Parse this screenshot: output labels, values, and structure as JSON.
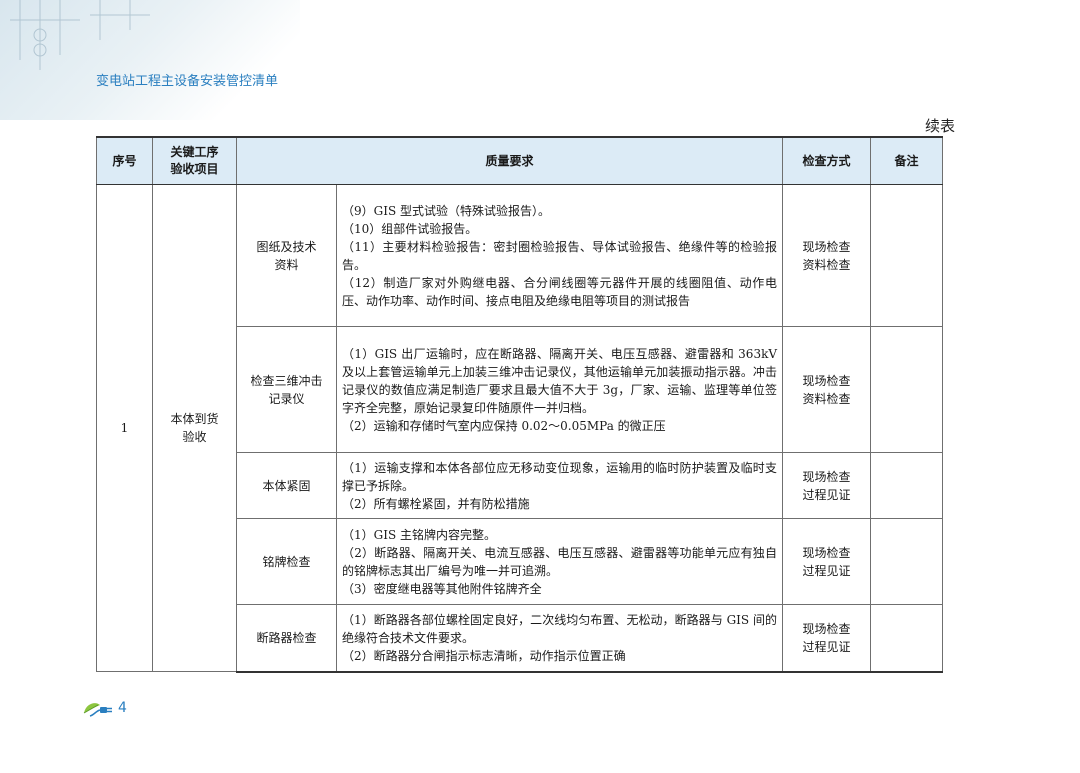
{
  "header": {
    "title": "变电站工程主设备安装管控清单"
  },
  "continued_label": "续表",
  "table": {
    "headers": {
      "no": "序号",
      "item": "关键工序\n验收项目",
      "req": "质量要求",
      "method": "检查方式",
      "note": "备注"
    },
    "group": {
      "no": "1",
      "name": "本体到货\n验收"
    },
    "rows": [
      {
        "sub": "图纸及技术\n资料",
        "req": [
          "（9）GIS 型式试验（特殊试验报告）。",
          "（10）组部件试验报告。",
          "（11）主要材料检验报告：密封圈检验报告、导体试验报告、绝缘件等的检验报告。",
          "（12）制造厂家对外购继电器、合分闸线圈等元器件开展的线圈阻值、动作电压、动作功率、动作时间、接点电阻及绝缘电阻等项目的测试报告"
        ],
        "method": "现场检查\n资料检查",
        "note": ""
      },
      {
        "sub": "检查三维冲击\n记录仪",
        "req": [
          "（1）GIS 出厂运输时，应在断路器、隔离开关、电压互感器、避雷器和 363kV 及以上套管运输单元上加装三维冲击记录仪，其他运输单元加装振动指示器。冲击记录仪的数值应满足制造厂要求且最大值不大于 3g，厂家、运输、监理等单位签字齐全完整，原始记录复印件随原件一并归档。",
          "（2）运输和存储时气室内应保持 0.02～0.05MPa 的微正压"
        ],
        "method": "现场检查\n资料检查",
        "note": ""
      },
      {
        "sub": "本体紧固",
        "req": [
          "（1）运输支撑和本体各部位应无移动变位现象，运输用的临时防护装置及临时支撑已予拆除。",
          "（2）所有螺栓紧固，并有防松措施"
        ],
        "method": "现场检查\n过程见证",
        "note": ""
      },
      {
        "sub": "铭牌检查",
        "req": [
          "（1）GIS 主铭牌内容完整。",
          "（2）断路器、隔离开关、电流互感器、电压互感器、避雷器等功能单元应有独自的铭牌标志其出厂编号为唯一并可追溯。",
          "（3）密度继电器等其他附件铭牌齐全"
        ],
        "method": "现场检查\n过程见证",
        "note": ""
      },
      {
        "sub": "断路器检查",
        "req": [
          "（1）断路器各部位螺栓固定良好，二次线均匀布置、无松动，断路器与 GIS 间的绝缘符合技术文件要求。",
          "（2）断路器分合闸指示标志清晰，动作指示位置正确"
        ],
        "method": "现场检查\n过程见证",
        "note": ""
      }
    ]
  },
  "footer": {
    "page": "4",
    "icon": "plug-leaf-icon"
  },
  "colors": {
    "accent": "#2a7fc0",
    "header_bg": "#dcebf6"
  }
}
